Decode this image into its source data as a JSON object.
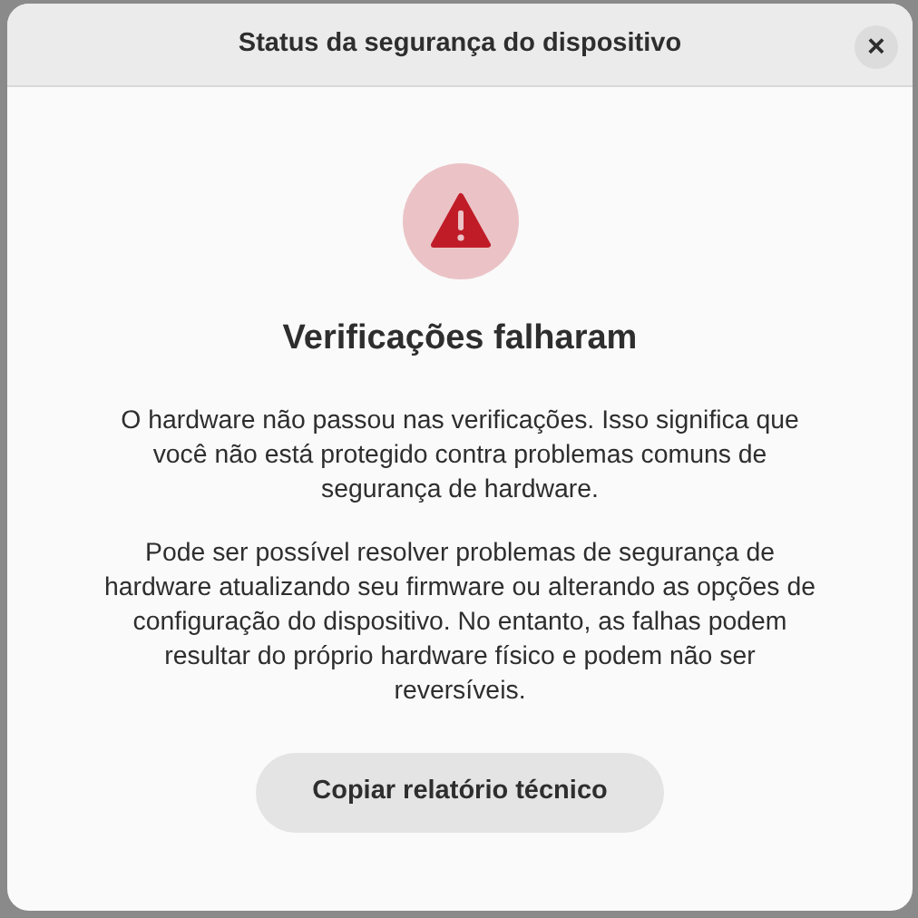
{
  "dialog": {
    "title": "Status da segurança do dispositivo",
    "close_label": "×"
  },
  "status": {
    "heading": "Verificações falharam",
    "paragraphs": [
      "O hardware não passou nas verificações. Isso significa que você não está protegido contra problemas comuns de segurança de hardware.",
      "Pode ser possível resolver problemas de segurança de hardware atualizando seu firmware ou alterando as opções de configuração do dispositivo. No entanto, as falhas podem resultar do próprio hardware físico e podem não ser reversíveis."
    ]
  },
  "buttons": [
    "Copiar relatório técnico"
  ]
}
